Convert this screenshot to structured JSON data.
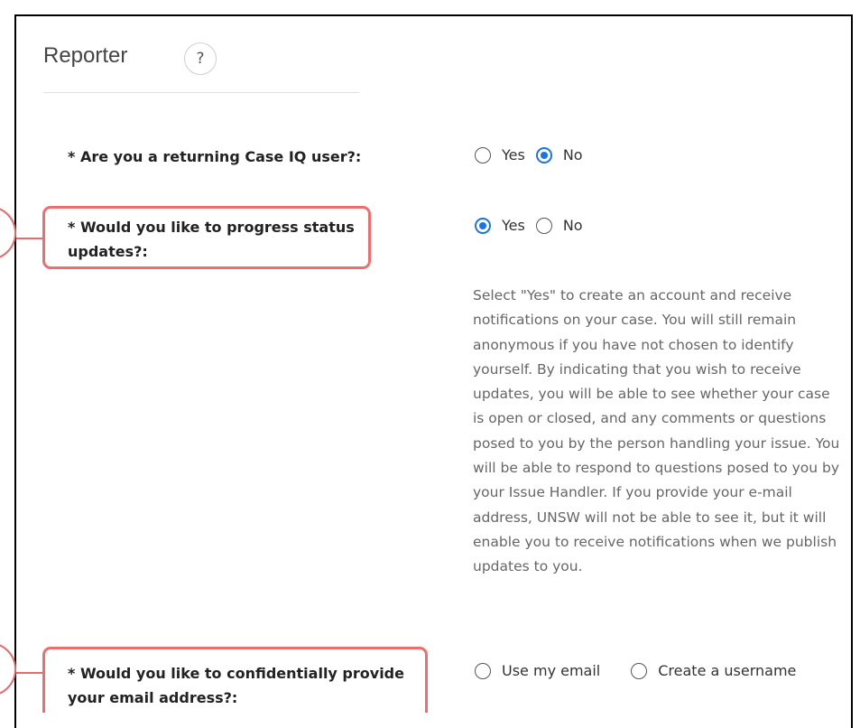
{
  "section": {
    "title": "Reporter",
    "help_glyph": "?"
  },
  "questions": [
    {
      "label": "* Are you a returning Case IQ user?:",
      "options": [
        {
          "label": "Yes",
          "checked": false
        },
        {
          "label": "No",
          "checked": true
        }
      ]
    },
    {
      "label": "* Would you like to progress status updates?:",
      "options": [
        {
          "label": "Yes",
          "checked": true
        },
        {
          "label": "No",
          "checked": false
        }
      ],
      "help_text": "Select \"Yes\" to create an account and receive notifications on your case. You will still remain anonymous if you have not chosen to identify yourself. By indicating that you wish to receive updates, you will be able to see whether your case is open or closed, and any comments or questions posed to you by the person handling your issue. You will be able to respond to questions posed to you by your Issue Handler. If you provide your e-mail address, UNSW will not be able to see it, but it will enable you to receive notifications when we publish updates to you."
    },
    {
      "label": "* Would you like to confidentially provide your email address?:",
      "options": [
        {
          "label": "Use my email",
          "checked": false
        },
        {
          "label": "Create a username",
          "checked": false
        }
      ]
    }
  ],
  "colors": {
    "highlight": "#ee6e6e",
    "radio_accent": "#1a73e8"
  }
}
